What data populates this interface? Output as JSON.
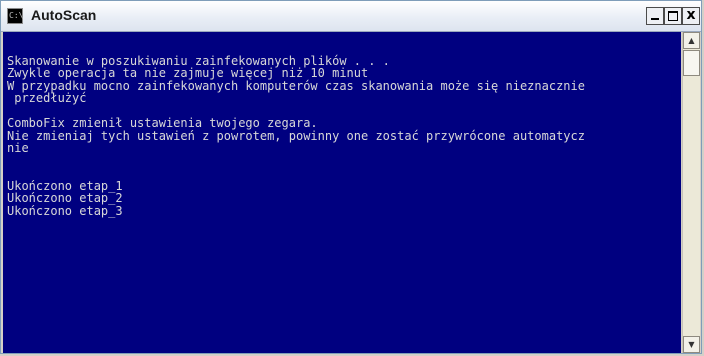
{
  "window": {
    "title": "AutoScan",
    "icon_label": "C:\\",
    "icon": "console-app-icon",
    "controls": {
      "minimize": "minimize-icon",
      "maximize": "maximize-icon",
      "close": "close-icon",
      "close_glyph": "x"
    }
  },
  "console": {
    "background": "#000080",
    "foreground": "#d8d8d8",
    "lines": [
      "",
      "Skanowanie w poszukiwaniu zainfekowanych plików . . .",
      "Zwykle operacja ta nie zajmuje więcej niż 10 minut",
      "W przypadku mocno zainfekowanych komputerów czas skanowania może się nieznacznie",
      " przedłużyć",
      "",
      "ComboFix zmienił ustawienia twojego zegara.",
      "Nie zmieniaj tych ustawień z powrotem, powinny one zostać przywrócone automatycz",
      "nie",
      "",
      "",
      "Ukończono etap_1",
      "Ukończono etap_2",
      "Ukończono etap_3"
    ]
  },
  "scrollbar": {
    "up": "scroll-up-arrow-icon",
    "down": "scroll-down-arrow-icon",
    "up_glyph": "▲",
    "down_glyph": "▼"
  }
}
